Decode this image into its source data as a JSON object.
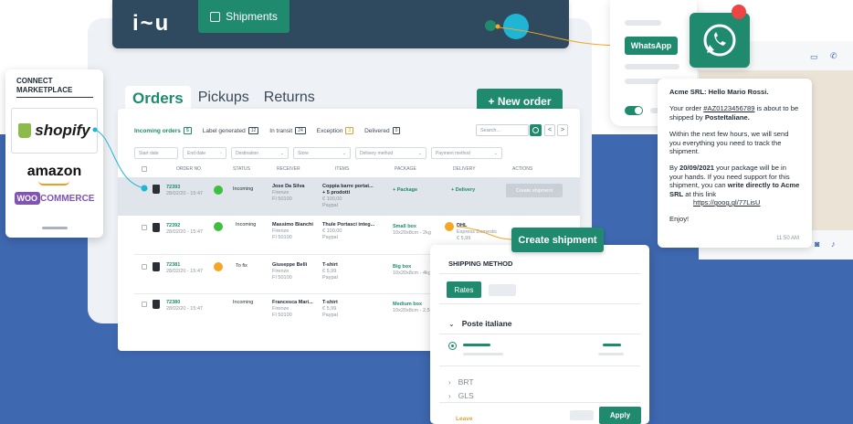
{
  "app": {
    "logo": "i~u",
    "shipments_tab": "Shipments"
  },
  "marketplace": {
    "title": "CONNECT MARKETPLACE",
    "shopify": "shopify",
    "amazon": "amazon",
    "woo_prefix": "WOO",
    "woo_suffix": "COMMERCE"
  },
  "tabs": [
    "Orders",
    "Pickups",
    "Returns"
  ],
  "new_order": "+ New order",
  "status_tabs": [
    {
      "label": "Incoming orders",
      "count": "5"
    },
    {
      "label": "Label generated",
      "count": "12"
    },
    {
      "label": "In transit",
      "count": "24"
    },
    {
      "label": "Exception",
      "count": "3"
    },
    {
      "label": "Delivered",
      "count": "0"
    }
  ],
  "search": {
    "placeholder": "Search..."
  },
  "pager": {
    "prev": "<",
    "next": ">"
  },
  "filters": [
    "Start date",
    "End date",
    "Destination",
    "Store",
    "Delivery method",
    "Payment method"
  ],
  "columns": [
    "ORDER NO.",
    "STATUS",
    "RECEIVER",
    "ITEMS",
    "PACKAGE",
    "DELIVERY",
    "ACTIONS"
  ],
  "rows": [
    {
      "id": "72393",
      "date": "28/02/20 - 15:47",
      "status": "Incoming",
      "status_color": "#3fbf3f",
      "receiver": "Jose Da Silva",
      "city": "Firenze",
      "zip": "FI 50100",
      "items": "Coppia barre portat...",
      "items2": "+ 5 prodotti",
      "price": "€ 100,00",
      "pay": "Paypal",
      "package": "+ Package",
      "package_sub": "",
      "delivery": "+ Delivery",
      "delivery_sub": "",
      "action": "Create shipment"
    },
    {
      "id": "72392",
      "date": "28/02/20 - 15:47",
      "status": "Incoming",
      "status_color": "#3fbf3f",
      "receiver": "Massimo Bianchi",
      "city": "Firenze",
      "zip": "FI 50100",
      "items": "Thule Portasci integ...",
      "items2": "",
      "price": "€ 100,00",
      "pay": "Paypal",
      "package": "Small box",
      "package_sub": "10x20x8cm - 2kg",
      "delivery": "DHL",
      "delivery_sub": "Express Domestic",
      "delivery_sub2": "€ 5,99",
      "action": ""
    },
    {
      "id": "72381",
      "date": "28/02/20 - 15:47",
      "status": "To fix",
      "status_color": "#f5a623",
      "receiver": "Giuseppe Belli",
      "city": "Firenze",
      "zip": "FI 50100",
      "items": "T-shirt",
      "items2": "",
      "price": "€ 5,99",
      "pay": "Paypal",
      "package": "Big box",
      "package_sub": "10x20x8cm - 4kg",
      "delivery": "",
      "delivery_sub": "",
      "action": ""
    },
    {
      "id": "72380",
      "date": "28/02/20 - 15:47",
      "status": "Incoming",
      "status_color": "",
      "receiver": "Francesca Mari...",
      "city": "Firenze",
      "zip": "FI 50100",
      "items": "T-shirt",
      "items2": "",
      "price": "€ 5,99",
      "pay": "Paypal",
      "package": "Medium box",
      "package_sub": "10x20x8cm - 2,5kg",
      "delivery": "",
      "delivery_sub": "",
      "action": ""
    }
  ],
  "create_shipment": "Create shipment",
  "shipping": {
    "title": "SHIPPING METHOD",
    "rates": "Rates",
    "carrier_open": "Poste italiane",
    "carriers": [
      "BRT",
      "GLS"
    ],
    "leave": "Leave",
    "apply": "Apply"
  },
  "whatsapp": {
    "label": "WhatsApp",
    "greeting": "Acme SRL: Hello Mario Rossi.",
    "msg1_a": "Your order ",
    "msg1_order": "#AZ0123456789",
    "msg1_b": " is about to be shipped by ",
    "msg1_carrier": "PosteItaliane.",
    "msg2": "Within the next few hours, we will send you everything you need to track the shipment.",
    "msg3_a": "By ",
    "msg3_date": "20/09/2021",
    "msg3_b": " your package will be in your hands. If you need support for this shipment, you can ",
    "msg3_bold": "write directly to Acme SRL",
    "msg3_c": " at this link",
    "link": "https://goog.gl/77LisU",
    "sign": "Enjoy!",
    "time": "11:50 AM"
  },
  "colors": {
    "accent": "#1f8a6e",
    "navy": "#2f4a5f",
    "blue_bg": "#3e68b0",
    "orange": "#f5a623"
  }
}
